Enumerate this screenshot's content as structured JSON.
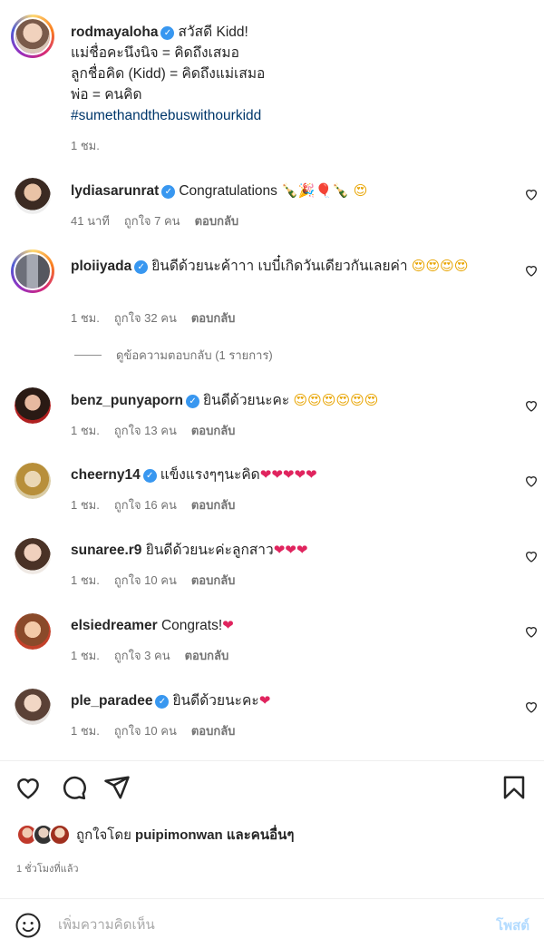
{
  "caption": {
    "username": "rodmayaloha",
    "lines": [
      "สวัสดี Kidd!",
      "แม่ชื่อคะนึงนิจ = คิดถึงเสมอ",
      "ลูกชื่อคิด (Kidd) = คิดถึงแม่เสมอ",
      "พ่อ = คนคิด"
    ],
    "hashtag": "#sumethandthebuswithourkidd",
    "time": "1 ชม."
  },
  "comments": [
    {
      "username": "lydiasarunrat",
      "verified": true,
      "text": "Congratulations ",
      "emoji": "🍾🎉🎈🍾 😍",
      "time": "41 นาที",
      "likes": "ถูกใจ 7 คน",
      "reply": "ตอบกลับ"
    },
    {
      "username": "ploiiyada",
      "verified": true,
      "text": "ยินดีด้วยนะค้าาา เบบี๋เกิดวันเดียวกันเลยค่า ",
      "emoji": "😍😍😍😍",
      "time": "1 ชม.",
      "likes": "ถูกใจ 32 คน",
      "reply": "ตอบกลับ"
    },
    {
      "username": "benz_punyaporn",
      "verified": true,
      "text": "ยินดีด้วยนะคะ ",
      "emoji": "😍😍😍😍😍😍",
      "time": "1 ชม.",
      "likes": "ถูกใจ 13 คน",
      "reply": "ตอบกลับ"
    },
    {
      "username": "cheerny14",
      "verified": true,
      "text": "แข็งแรงๆๆนะคิด",
      "emoji": "❤❤❤❤❤",
      "time": "1 ชม.",
      "likes": "ถูกใจ 16 คน",
      "reply": "ตอบกลับ"
    },
    {
      "username": "sunaree.r9",
      "verified": false,
      "text": "ยินดีด้วยนะค่ะลูกสาว",
      "emoji": "❤❤❤",
      "time": "1 ชม.",
      "likes": "ถูกใจ 10 คน",
      "reply": "ตอบกลับ"
    },
    {
      "username": "elsiedreamer",
      "verified": false,
      "text": "Congrats!",
      "emoji": "❤",
      "time": "1 ชม.",
      "likes": "ถูกใจ 3 คน",
      "reply": "ตอบกลับ"
    },
    {
      "username": "ple_paradee",
      "verified": true,
      "text": "ยินดีด้วยนะคะ",
      "emoji": "❤",
      "time": "1 ชม.",
      "likes": "ถูกใจ 10 คน",
      "reply": "ตอบกลับ"
    }
  ],
  "view_replies": "ดูข้อความตอบกลับ (1 รายการ)",
  "liked_by": {
    "prefix": "ถูกใจโดย",
    "user": "puipimonwan",
    "suffix": "และคนอื่นๆ"
  },
  "post_time": "1 ชั่วโมงที่แล้ว",
  "composer": {
    "placeholder": "เพิ่มความคิดเห็น",
    "post_label": "โพสต์"
  },
  "icons": [
    "heart-icon",
    "comment-icon",
    "share-icon",
    "bookmark-icon",
    "emoji-icon"
  ],
  "colors": {
    "verified": "#3897f0",
    "hashtag": "#00376b",
    "meta": "#737373",
    "post_disabled": "#b3dbff"
  }
}
